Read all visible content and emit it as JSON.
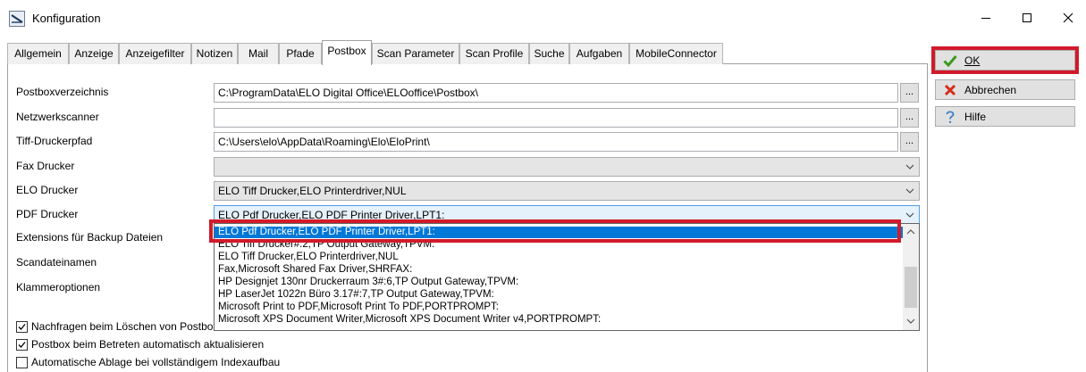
{
  "window": {
    "title": "Konfiguration"
  },
  "tabs": [
    "Allgemein",
    "Anzeige",
    "Anzeigefilter",
    "Notizen",
    "Mail",
    "Pfade",
    "Postbox",
    "Scan Parameter",
    "Scan Profile",
    "Suche",
    "Aufgaben",
    "MobileConnector"
  ],
  "active_tab": "Postbox",
  "fields": {
    "postboxverzeichnis": {
      "label": "Postboxverzeichnis",
      "value": "C:\\ProgramData\\ELO Digital Office\\ELOoffice\\Postbox\\"
    },
    "netzwerkscanner": {
      "label": "Netzwerkscanner",
      "value": ""
    },
    "tiff_druckerpfad": {
      "label": "Tiff-Druckerpfad",
      "value": "C:\\Users\\elo\\AppData\\Roaming\\Elo\\EloPrint\\"
    },
    "fax_drucker": {
      "label": "Fax Drucker",
      "value": ""
    },
    "elo_drucker": {
      "label": "ELO Drucker",
      "value": "ELO Tiff Drucker,ELO Printerdriver,NUL"
    },
    "pdf_drucker": {
      "label": "PDF Drucker",
      "value": "ELO Pdf Drucker,ELO PDF Printer Driver,LPT1:"
    },
    "extensions": {
      "label": "Extensions für Backup Dateien"
    },
    "scandateinamen": {
      "label": "Scandateinamen"
    },
    "klammeroptionen": {
      "label": "Klammeroptionen"
    }
  },
  "browse_label": "...",
  "dropdown_items": [
    "ELO Pdf Drucker,ELO PDF Printer Driver,LPT1:",
    "ELO Tiff Drucker#:2,TP Output Gateway,TPVM:",
    "ELO Tiff Drucker,ELO Printerdriver,NUL",
    "Fax,Microsoft Shared Fax Driver,SHRFAX:",
    "HP Designjet 130nr Druckerraum 3#:6,TP Output Gateway,TPVM:",
    "HP LaserJet 1022n Büro 3.17#:7,TP Output Gateway,TPVM:",
    "Microsoft Print to PDF,Microsoft Print To PDF,PORTPROMPT:",
    "Microsoft XPS Document Writer,Microsoft XPS Document Writer v4,PORTPROMPT:"
  ],
  "checkboxes": [
    {
      "label": "Nachfragen beim Löschen von Postbox",
      "checked": true
    },
    {
      "label": "Postbox beim Betreten automatisch aktualisieren",
      "checked": true
    },
    {
      "label": "Automatische Ablage bei vollständigem Indexaufbau",
      "checked": false
    }
  ],
  "buttons": {
    "ok": "OK",
    "cancel": "Abbrechen",
    "help": "Hilfe"
  },
  "colors": {
    "highlight_outline": "#d11a2a",
    "selection": "#0078d7"
  }
}
